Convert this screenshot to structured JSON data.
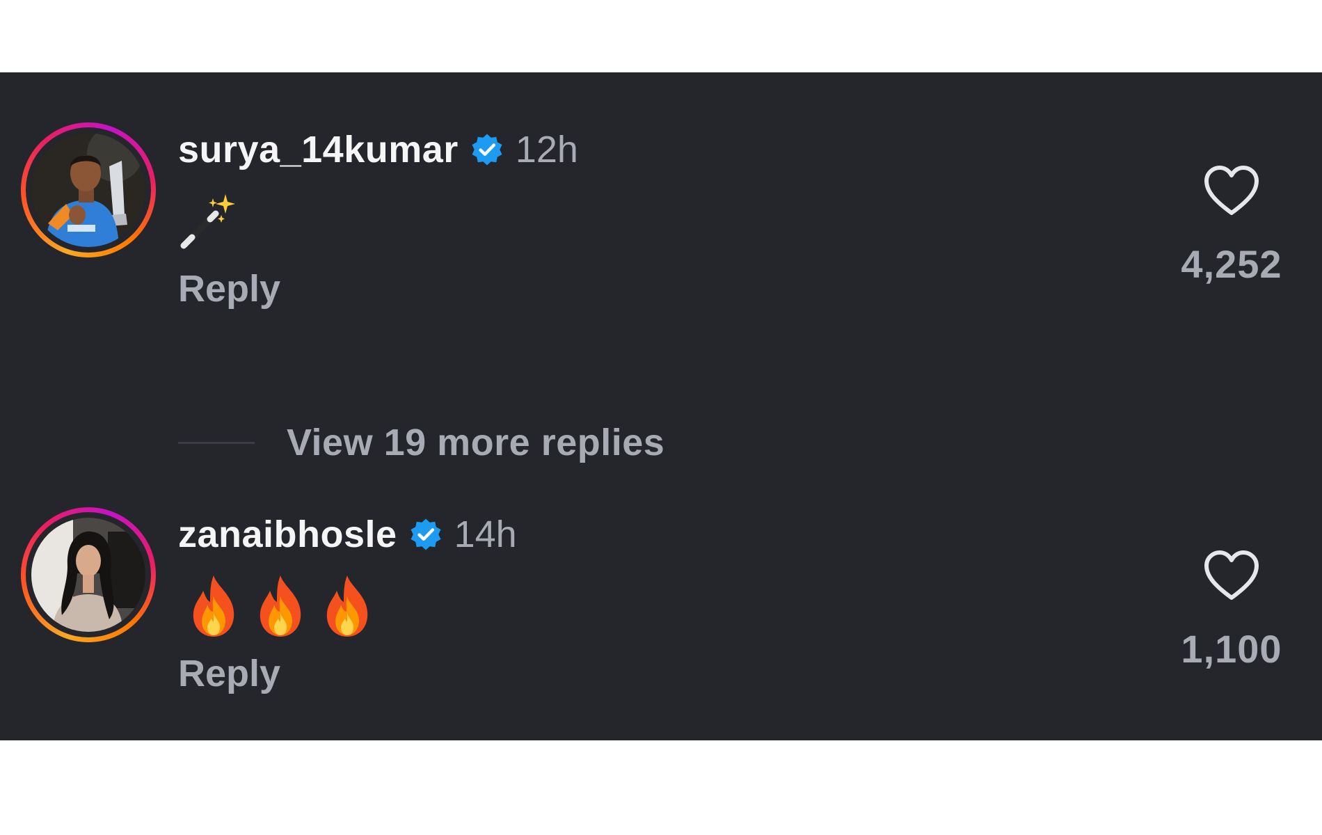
{
  "colors": {
    "background": "#24262c",
    "username": "#f5f5f5",
    "secondary_text": "#a8abb3",
    "verified_badge": "#1d9bf0"
  },
  "comments": [
    {
      "username": "surya_14kumar",
      "verified": true,
      "time": "12h",
      "content_emoji": [
        "magic-wand"
      ],
      "reply_label": "Reply",
      "like_count": "4,252",
      "view_replies_label": "View 19 more replies"
    },
    {
      "username": "zanaibhosle",
      "verified": true,
      "time": "14h",
      "content_emoji": [
        "fire",
        "fire",
        "fire"
      ],
      "reply_label": "Reply",
      "like_count": "1,100"
    }
  ]
}
